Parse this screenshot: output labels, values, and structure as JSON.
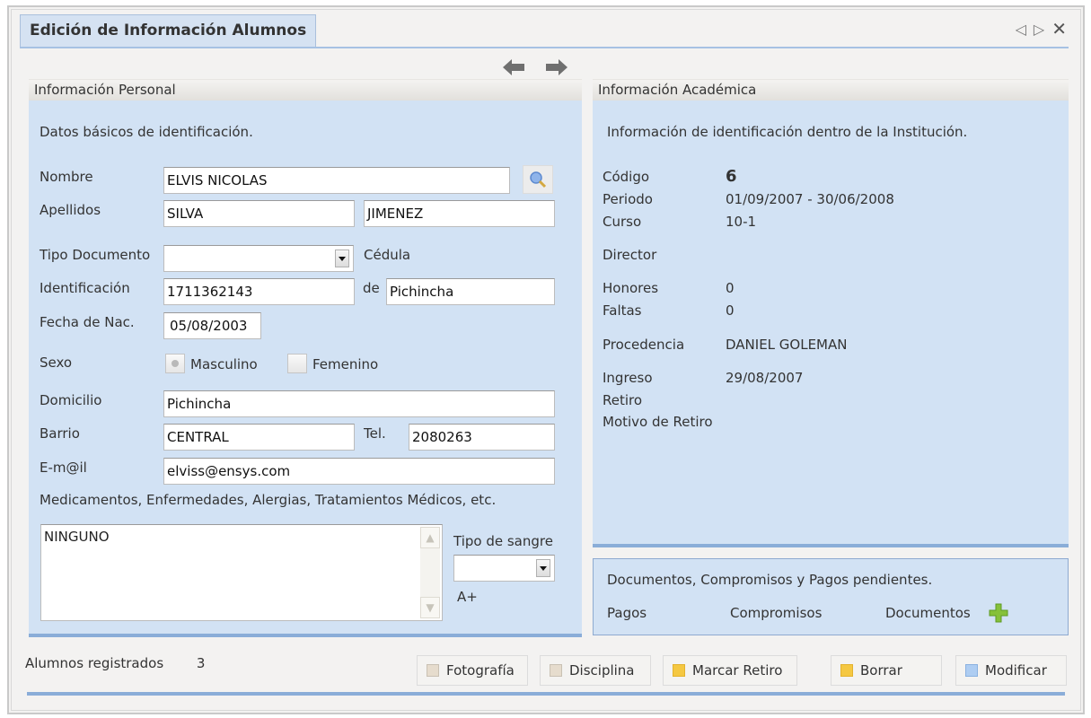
{
  "window": {
    "tab_title": "Edición de Información Alumnos",
    "controls": {
      "prev": "◁",
      "next": "▷",
      "close": "✕"
    }
  },
  "nav": {
    "back_icon": "arrow-left-icon",
    "forward_icon": "arrow-right-icon"
  },
  "personal": {
    "title": "Información Personal",
    "description": "Datos básicos de identificación.",
    "fields": {
      "nombre": {
        "label": "Nombre",
        "value": "ELVIS NICOLAS"
      },
      "apellidos": {
        "label": "Apellidos",
        "value1": "SILVA",
        "value2": "JIMENEZ"
      },
      "tipo_documento": {
        "label": "Tipo Documento",
        "value": "",
        "display": "Cédula"
      },
      "identificacion": {
        "label": "Identificación",
        "value": "1711362143",
        "de_label": "de",
        "de_value": "Pichincha"
      },
      "fecha_nac": {
        "label": "Fecha de Nac.",
        "value": "05/08/2003"
      },
      "sexo": {
        "label": "Sexo",
        "options": [
          {
            "label": "Masculino",
            "selected": true
          },
          {
            "label": "Femenino",
            "selected": false
          }
        ]
      },
      "domicilio": {
        "label": "Domicilio",
        "value": "Pichincha"
      },
      "barrio": {
        "label": "Barrio",
        "value": "CENTRAL"
      },
      "tel": {
        "label": "Tel.",
        "value": "2080263"
      },
      "email": {
        "label": "E-m@il",
        "value": "elviss@ensys.com"
      },
      "medical": {
        "label": "Medicamentos, Enfermedades, Alergias, Tratamientos Médicos, etc.",
        "value": "NINGUNO"
      },
      "sangre": {
        "label": "Tipo de sangre",
        "value": "",
        "display": "A+"
      }
    }
  },
  "academic": {
    "title": "Información Académica",
    "description": "Información de identificación dentro de la Institución.",
    "rows": {
      "codigo": {
        "label": "Código",
        "value": "6"
      },
      "periodo": {
        "label": "Periodo",
        "value": "01/09/2007 - 30/06/2008"
      },
      "curso": {
        "label": "Curso",
        "value": "10-1"
      },
      "director": {
        "label": "Director",
        "value": ""
      },
      "honores": {
        "label": "Honores",
        "value": "0"
      },
      "faltas": {
        "label": "Faltas",
        "value": "0"
      },
      "procedencia": {
        "label": "Procedencia",
        "value": "DANIEL GOLEMAN"
      },
      "ingreso": {
        "label": "Ingreso",
        "value": "29/08/2007"
      },
      "retiro": {
        "label": "Retiro",
        "value": ""
      },
      "motivo": {
        "label": "Motivo de Retiro",
        "value": ""
      }
    }
  },
  "docs": {
    "description": "Documentos, Compromisos y Pagos pendientes.",
    "pagos": "Pagos",
    "compromisos": "Compromisos",
    "documentos": "Documentos"
  },
  "footer": {
    "registered_label": "Alumnos registrados",
    "registered_count": "3",
    "buttons": [
      {
        "label": "Fotografía",
        "color": "#e6dccd"
      },
      {
        "label": "Disciplina",
        "color": "#e6dccd"
      },
      {
        "label": "Marcar Retiro",
        "color": "#f5c842"
      },
      {
        "label": "Borrar",
        "color": "#f5c842"
      },
      {
        "label": "Modificar",
        "color": "#aecdf2"
      }
    ]
  },
  "colors": {
    "panel_bg": "#d2e2f4",
    "accent_bar": "#8aadd8",
    "tab_bg": "#d5e2f2"
  }
}
